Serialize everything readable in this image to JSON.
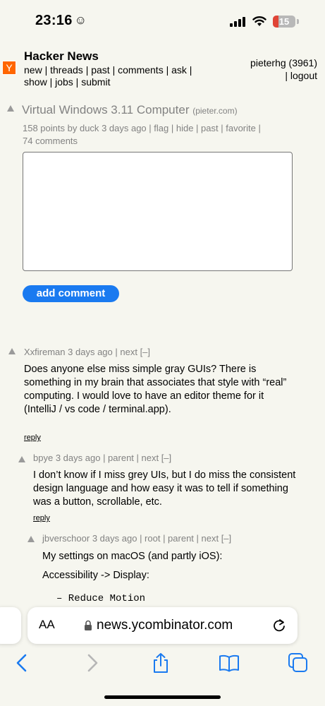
{
  "status_bar": {
    "time": "23:16",
    "time_icon": "☺",
    "battery": "15"
  },
  "header": {
    "logo": "Y",
    "title": "Hacker News",
    "nav": [
      "new",
      "threads",
      "past",
      "comments",
      "ask",
      "show",
      "jobs",
      "submit"
    ],
    "user": "pieterhg (3961)",
    "logout": "logout"
  },
  "story": {
    "title": "Virtual Windows 3.11 Computer",
    "domain": "(pieter.com)",
    "points": "158 points",
    "by": "duck",
    "age": "3 days ago",
    "actions": [
      "flag",
      "hide",
      "past",
      "favorite"
    ],
    "comments": "74 comments"
  },
  "comment_form": {
    "button": "add comment"
  },
  "comments": [
    {
      "user": "Xxfireman",
      "age": "3 days ago",
      "links": "| next [–]",
      "text": "Does anyone else miss simple gray GUIs? There is something in my brain that associates that style with “real” computing. I would love to have an editor theme for it (IntelliJ / vs code / terminal.app).",
      "reply": "reply"
    },
    {
      "user": "bpye",
      "age": "3 days ago",
      "links": "| parent | next [–]",
      "text": "I don’t know if I miss grey UIs, but I do miss the consistent design language and how easy it was to tell if something was a button, scrollable, etc.",
      "reply": "reply"
    },
    {
      "user": "jbverschoor",
      "age": "3 days ago",
      "links": "| root | parent | next [–]",
      "line1": "My settings on macOS (and partly iOS):",
      "line2": "Accessibility -> Display:",
      "code": "– Reduce Motion"
    }
  ],
  "browser": {
    "aa": "AA",
    "url": "news.ycombinator.com"
  }
}
